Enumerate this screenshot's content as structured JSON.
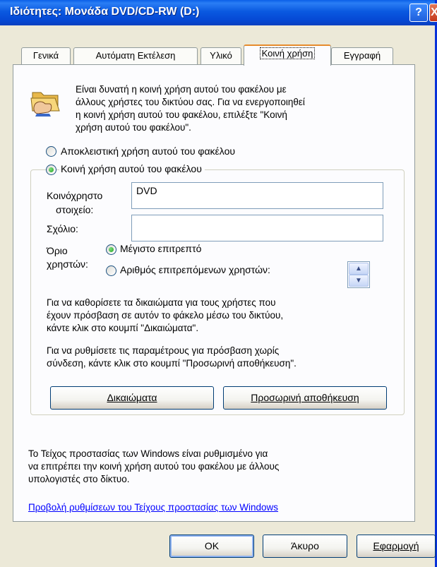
{
  "window": {
    "title": "Ιδιότητες: Μονάδα DVD/CD-RW (D:)",
    "help_icon": "?",
    "close_icon": "X"
  },
  "tabs": [
    {
      "label": "Γενικά",
      "active": false
    },
    {
      "label": "Αυτόματη Εκτέλεση",
      "active": false
    },
    {
      "label": "Υλικό",
      "active": false
    },
    {
      "label": "Κοινή χρήση",
      "active": true
    },
    {
      "label": "Εγγραφή",
      "active": false
    }
  ],
  "sharing": {
    "folder_icon": "shared-folder-icon",
    "intro_lines": [
      "Είναι δυνατή η κοινή χρήση αυτού του φακέλου με",
      "άλλους χρήστες του δικτύου σας. Για να ενεργοποιηθεί",
      "η κοινή χρήση αυτού του φακέλου, επιλέξτε \"Κοινή",
      "χρήση αυτού του φακέλου\"."
    ],
    "radio_exclusive": "Αποκλειστική χρήση αυτού του φακέλου",
    "radio_share": "Κοινή χρήση αυτού του φακέλου",
    "share_name_label_1": "Κοινόχρηστο",
    "share_name_label_2": "στοιχείο:",
    "share_name_value": "DVD",
    "comment_label": "Σχόλιο:",
    "comment_value": "",
    "user_limit_label_1": "Όριο",
    "user_limit_label_2": "χρηστών:",
    "radio_max_allowed": "Μέγιστο επιτρεπτό",
    "radio_allowed_users": "Αριθμός επιτρεπόμενων χρηστών:",
    "spinner_value": "",
    "permissions_help_lines": [
      "Για να καθορίσετε τα δικαιώματα για τους χρήστες που",
      "έχουν πρόσβαση σε αυτόν το φάκελο μέσω του δικτύου,",
      "κάντε κλικ στο κουμπί \"Δικαιώματα\"."
    ],
    "offline_help_lines": [
      "Για να ρυθμίσετε τις παραμέτρους για πρόσβαση χωρίς",
      "σύνδεση, κάντε κλικ στο κουμπί \"Προσωρινή αποθήκευση\"."
    ],
    "permissions_button": "Δικαιώματα",
    "caching_button": "Προσωρινή αποθήκευση",
    "firewall_lines": [
      "Το Τείχος προστασίας των Windows είναι ρυθμισμένο για",
      "να επιτρέπει την κοινή χρήση αυτού του φακέλου με άλλους",
      "υπολογιστές στο δίκτυο."
    ],
    "firewall_link": "Προβολή ρυθμίσεων του Τείχους προστασίας των Windows"
  },
  "footer": {
    "ok": "OK",
    "cancel": "Άκυρο",
    "apply": "Εφαρμογή"
  },
  "colors": {
    "titlebar": "#0548d4",
    "dialog_bg": "#ece9d8",
    "active_tab_accent": "#e68b2c",
    "link": "#0000ff"
  }
}
